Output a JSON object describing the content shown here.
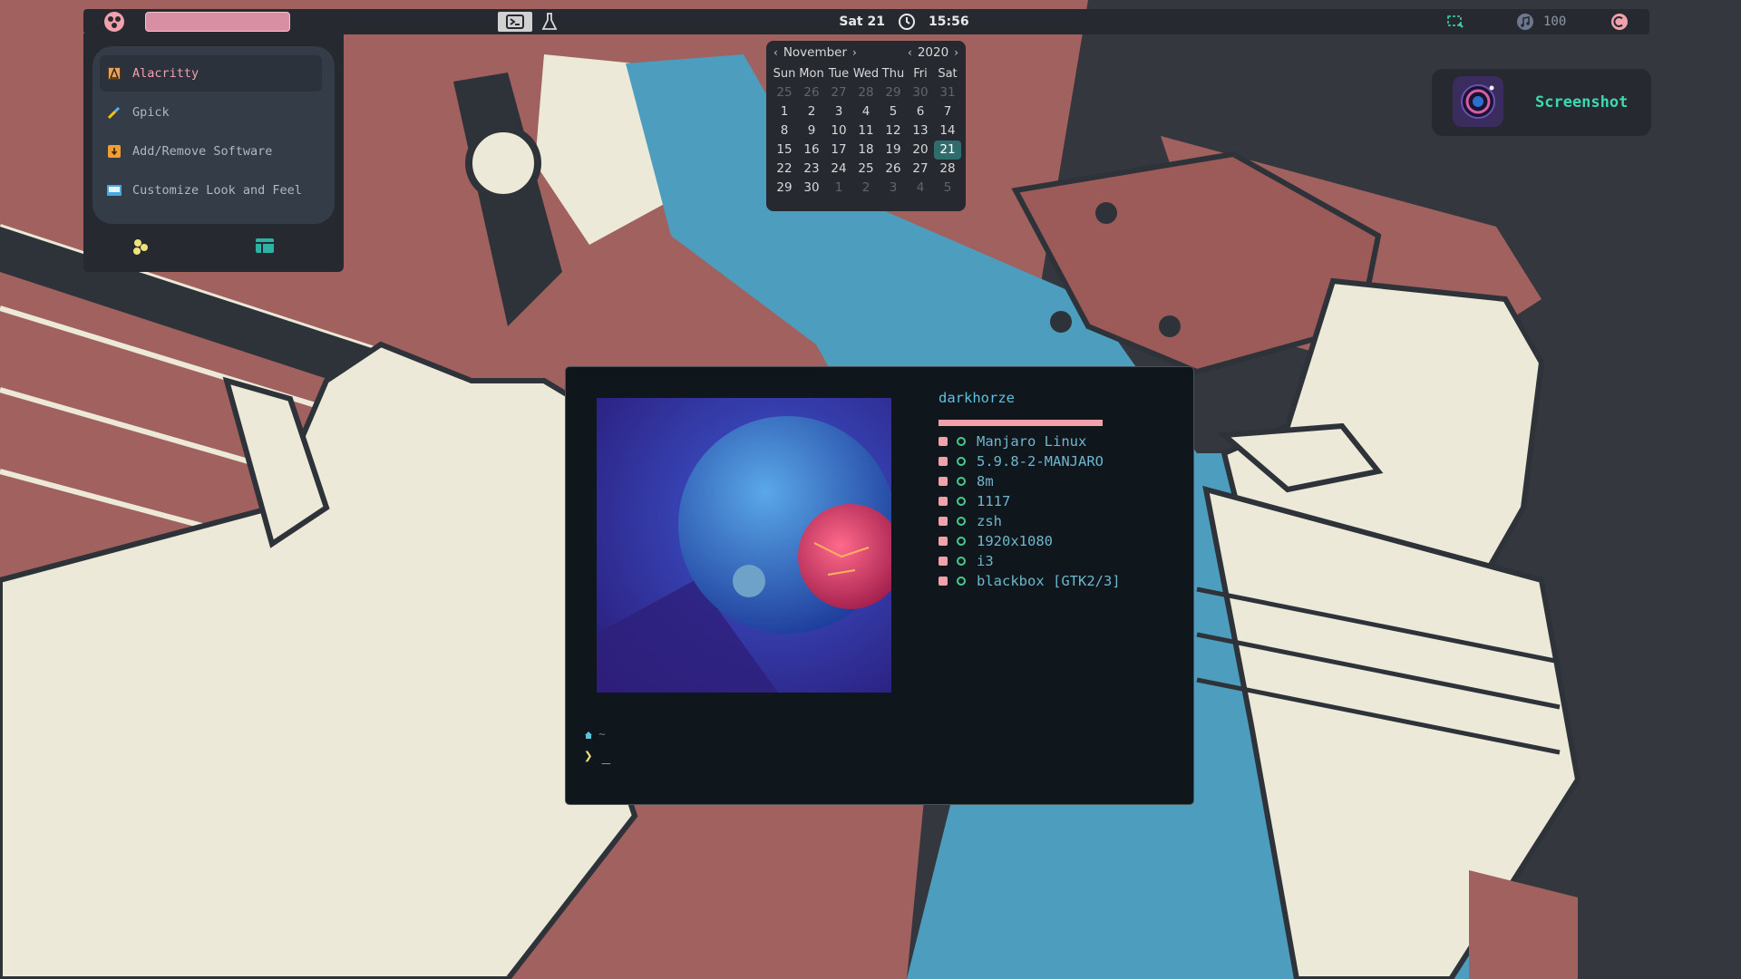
{
  "colors": {
    "background": "#34373d",
    "wall_red": "#a0615f",
    "wall_cream": "#ede9d9",
    "wall_blue": "#4d9dbf",
    "wall_dark": "#2d3339",
    "bar_bg": "#262a30",
    "accent_pink": "#f3a0ad",
    "accent_teal": "#3ed8b0",
    "term_bg": "#0f161c"
  },
  "topbar": {
    "search_value": "",
    "date": "Sat 21",
    "time": "15:56",
    "volume": "100",
    "icons": [
      "distro-logo-icon",
      "terminal-icon",
      "flask-icon",
      "clock-icon",
      "monitor-icon",
      "volume-icon",
      "power-icon"
    ]
  },
  "launcher": {
    "items": [
      {
        "label": "Alacritty",
        "icon": "alacritty-icon",
        "selected": true
      },
      {
        "label": "Gpick",
        "icon": "gpick-icon",
        "selected": false
      },
      {
        "label": "Add/Remove Software",
        "icon": "software-icon",
        "selected": false
      },
      {
        "label": "Customize Look and Feel",
        "icon": "appearance-icon",
        "selected": false
      }
    ],
    "footer_icons": [
      "apps-icon",
      "windows-icon"
    ]
  },
  "calendar": {
    "month": "November",
    "year": "2020",
    "weekdays": [
      "Sun",
      "Mon",
      "Tue",
      "Wed",
      "Thu",
      "Fri",
      "Sat"
    ],
    "today": "21",
    "days": [
      [
        "25",
        "26",
        "27",
        "28",
        "29",
        "30",
        "31"
      ],
      [
        "1",
        "2",
        "3",
        "4",
        "5",
        "6",
        "7"
      ],
      [
        "8",
        "9",
        "10",
        "11",
        "12",
        "13",
        "14"
      ],
      [
        "15",
        "16",
        "17",
        "18",
        "19",
        "20",
        "21"
      ],
      [
        "22",
        "23",
        "24",
        "25",
        "26",
        "27",
        "28"
      ],
      [
        "29",
        "30",
        "1",
        "2",
        "3",
        "4",
        "5"
      ]
    ]
  },
  "notification": {
    "label": "Screenshot",
    "icon": "camera-icon"
  },
  "terminal": {
    "fetch": {
      "user": "darkhorze",
      "rows": [
        {
          "icon": "distro-icon",
          "value": "Manjaro Linux"
        },
        {
          "icon": "kernel-icon",
          "value": "5.9.8-2-MANJARO"
        },
        {
          "icon": "uptime-icon",
          "value": "8m"
        },
        {
          "icon": "packages-icon",
          "value": "1117"
        },
        {
          "icon": "shell-icon",
          "value": "zsh"
        },
        {
          "icon": "resolution-icon",
          "value": "1920x1080"
        },
        {
          "icon": "wm-icon",
          "value": "i3"
        },
        {
          "icon": "theme-icon",
          "value": "blackbox [GTK2/3]"
        }
      ]
    },
    "prompt": {
      "path": "~",
      "symbol": "❯",
      "cursor": "_"
    }
  }
}
